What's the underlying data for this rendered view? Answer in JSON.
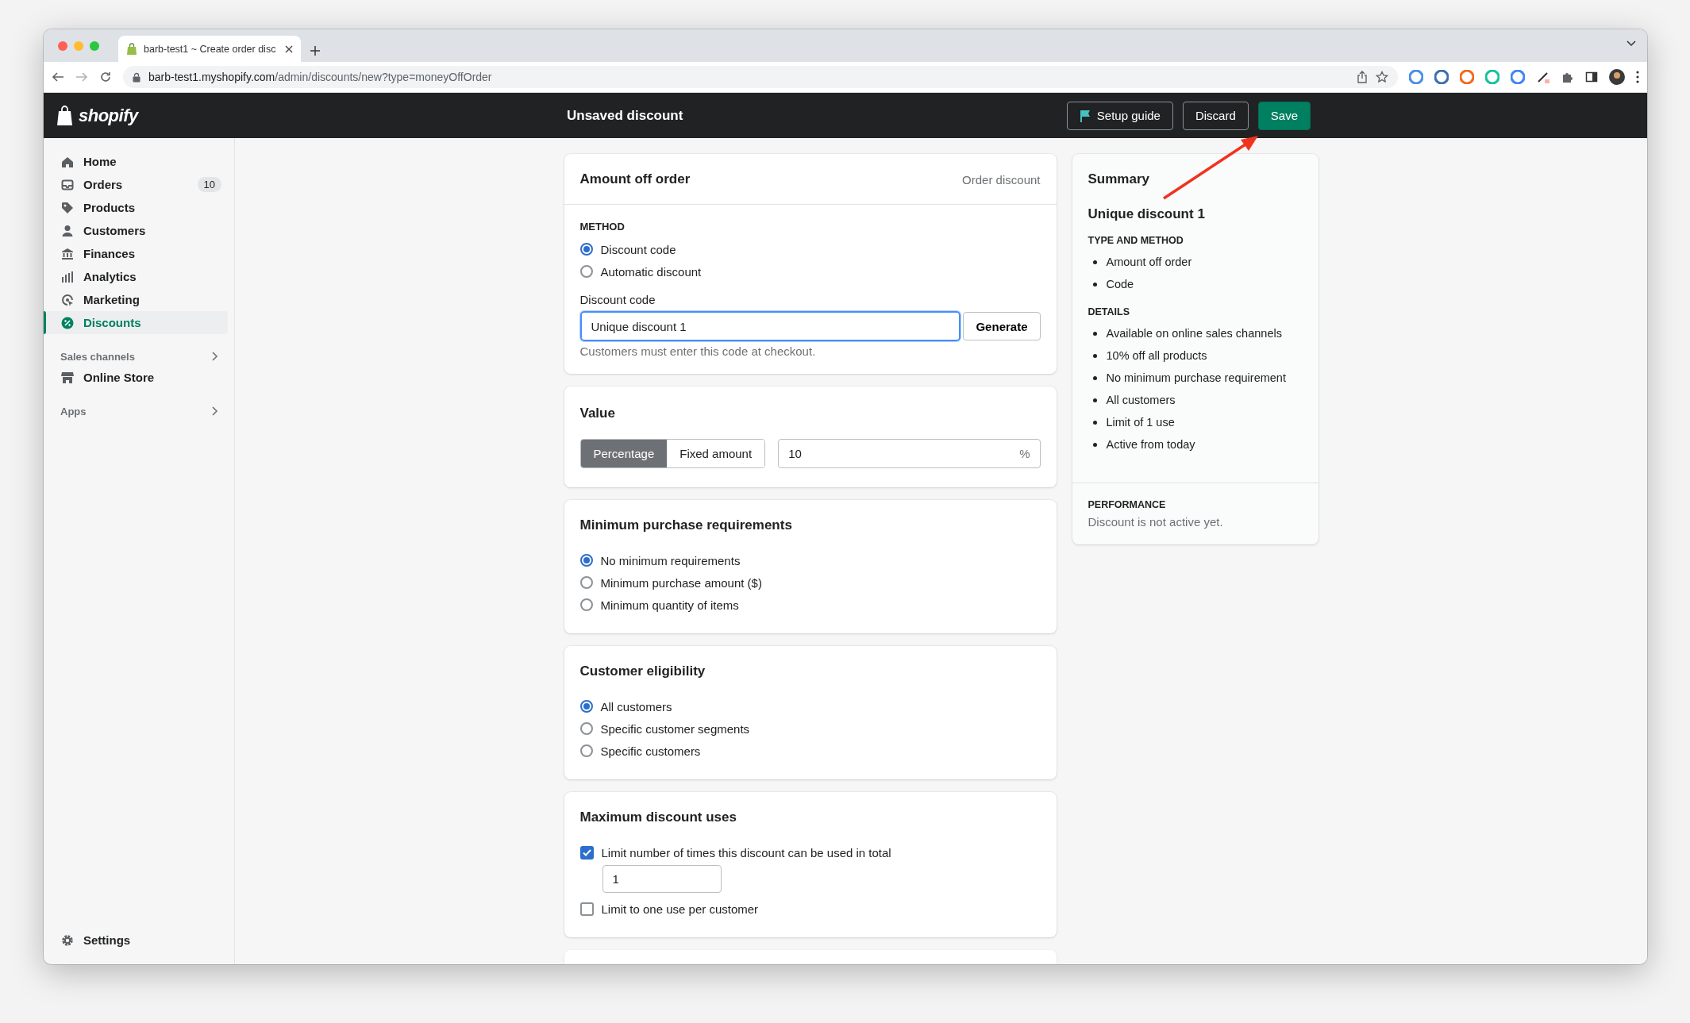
{
  "browser": {
    "tab_title": "barb-test1 ~ Create order disc",
    "url_host": "barb-test1.myshopify.com",
    "url_path": "/admin/discounts/new?type=moneyOffOrder"
  },
  "topbar": {
    "logo": "shopify",
    "title": "Unsaved discount",
    "buttons": [
      {
        "label": "Setup guide",
        "kind": "guide"
      },
      {
        "label": "Discard",
        "kind": "secondary"
      },
      {
        "label": "Save",
        "kind": "primary"
      }
    ]
  },
  "sidebar": {
    "items": [
      {
        "label": "Home",
        "selected": false
      },
      {
        "label": "Orders",
        "badge": "10",
        "selected": false
      },
      {
        "label": "Products",
        "selected": false
      },
      {
        "label": "Customers",
        "selected": false
      },
      {
        "label": "Finances",
        "selected": false
      },
      {
        "label": "Analytics",
        "selected": false
      },
      {
        "label": "Marketing",
        "selected": false
      },
      {
        "label": "Discounts",
        "selected": true
      }
    ],
    "sections": [
      {
        "title": "Sales channels",
        "items": [
          {
            "label": "Online Store",
            "selected": false
          }
        ]
      },
      {
        "title": "Apps"
      }
    ],
    "settings": "Settings"
  },
  "method_card": {
    "title": "Amount off order",
    "subtitle": "Order discount",
    "method_label": "METHOD",
    "options": [
      {
        "label": "Discount code",
        "selected": true
      },
      {
        "label": "Automatic discount",
        "selected": false
      }
    ],
    "code_label": "Discount code",
    "code_value": "Unique discount 1",
    "generate_button": "Generate",
    "help": "Customers must enter this code at checkout."
  },
  "value_card": {
    "title": "Value",
    "types": [
      {
        "label": "Percentage",
        "selected": true
      },
      {
        "label": "Fixed amount",
        "selected": false
      }
    ],
    "amount": "10",
    "suffix": "%"
  },
  "minimum_card": {
    "title": "Minimum purchase requirements",
    "options": [
      {
        "label": "No minimum requirements",
        "selected": true
      },
      {
        "label": "Minimum purchase amount ($)",
        "selected": false
      },
      {
        "label": "Minimum quantity of items",
        "selected": false
      }
    ]
  },
  "eligibility_card": {
    "title": "Customer eligibility",
    "options": [
      {
        "label": "All customers",
        "selected": true
      },
      {
        "label": "Specific customer segments",
        "selected": false
      },
      {
        "label": "Specific customers",
        "selected": false
      }
    ]
  },
  "uses_card": {
    "title": "Maximum discount uses",
    "options": [
      {
        "label": "Limit number of times this discount can be used in total",
        "checked": true,
        "value": "1"
      },
      {
        "label": "Limit to one use per customer",
        "checked": false
      }
    ]
  },
  "summary": {
    "title": "Summary",
    "code": "Unique discount 1",
    "sections": [
      {
        "heading": "TYPE AND METHOD",
        "items": [
          "Amount off order",
          "Code"
        ]
      },
      {
        "heading": "DETAILS",
        "items": [
          "Available on online sales channels",
          "10% off all products",
          "No minimum purchase requirement",
          "All customers",
          "Limit of 1 use",
          "Active from today"
        ]
      }
    ],
    "performance": {
      "heading": "PERFORMANCE",
      "text": "Discount is not active yet."
    }
  }
}
